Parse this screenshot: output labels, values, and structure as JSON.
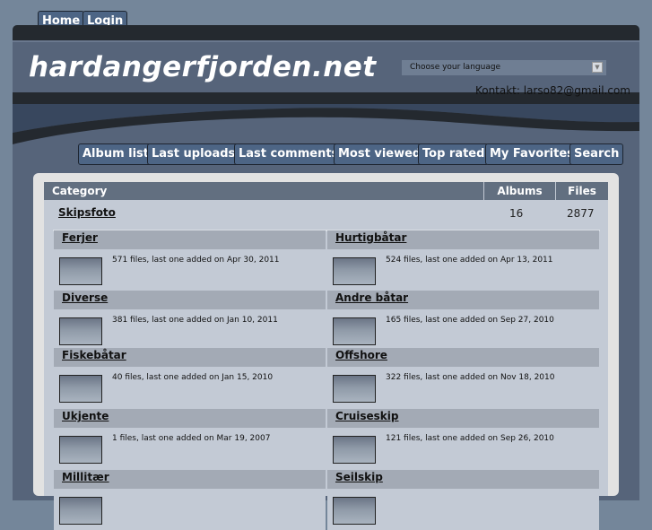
{
  "topnav": [
    {
      "label": "Home"
    },
    {
      "label": "Login"
    }
  ],
  "site_title": "hardangerfjorden.net",
  "language_select": {
    "value": "Choose your language"
  },
  "contact": "Kontakt: larso82@gmail.com",
  "nav": [
    {
      "label": "Album list"
    },
    {
      "label": "Last uploads"
    },
    {
      "label": "Last comments"
    },
    {
      "label": "Most viewed"
    },
    {
      "label": "Top rated"
    },
    {
      "label": "My Favorites"
    },
    {
      "label": "Search"
    }
  ],
  "table": {
    "headers": {
      "category": "Category",
      "albums": "Albums",
      "files": "Files"
    },
    "category": {
      "name": "Skipsfoto",
      "albums": "16",
      "files": "2877"
    },
    "albums": [
      {
        "name": "Ferjer",
        "info": "571 files, last one added on Apr 30, 2011"
      },
      {
        "name": "Hurtigbåtar",
        "info": "524 files, last one added on Apr 13, 2011"
      },
      {
        "name": "Diverse",
        "info": "381 files, last one added on Jan 10, 2011"
      },
      {
        "name": "Andre båtar",
        "info": "165 files, last one added on Sep 27, 2010"
      },
      {
        "name": "Fiskebåtar",
        "info": "40 files, last one added on Jan 15, 2010"
      },
      {
        "name": "Offshore",
        "info": "322 files, last one added on Nov 18, 2010"
      },
      {
        "name": "Ukjente",
        "info": "1 files, last one added on Mar 19, 2007"
      },
      {
        "name": "Cruiseskip",
        "info": "121 files, last one added on Sep 26, 2010"
      },
      {
        "name": "Millitær",
        "info": ""
      },
      {
        "name": "Seilskip",
        "info": ""
      }
    ]
  }
}
